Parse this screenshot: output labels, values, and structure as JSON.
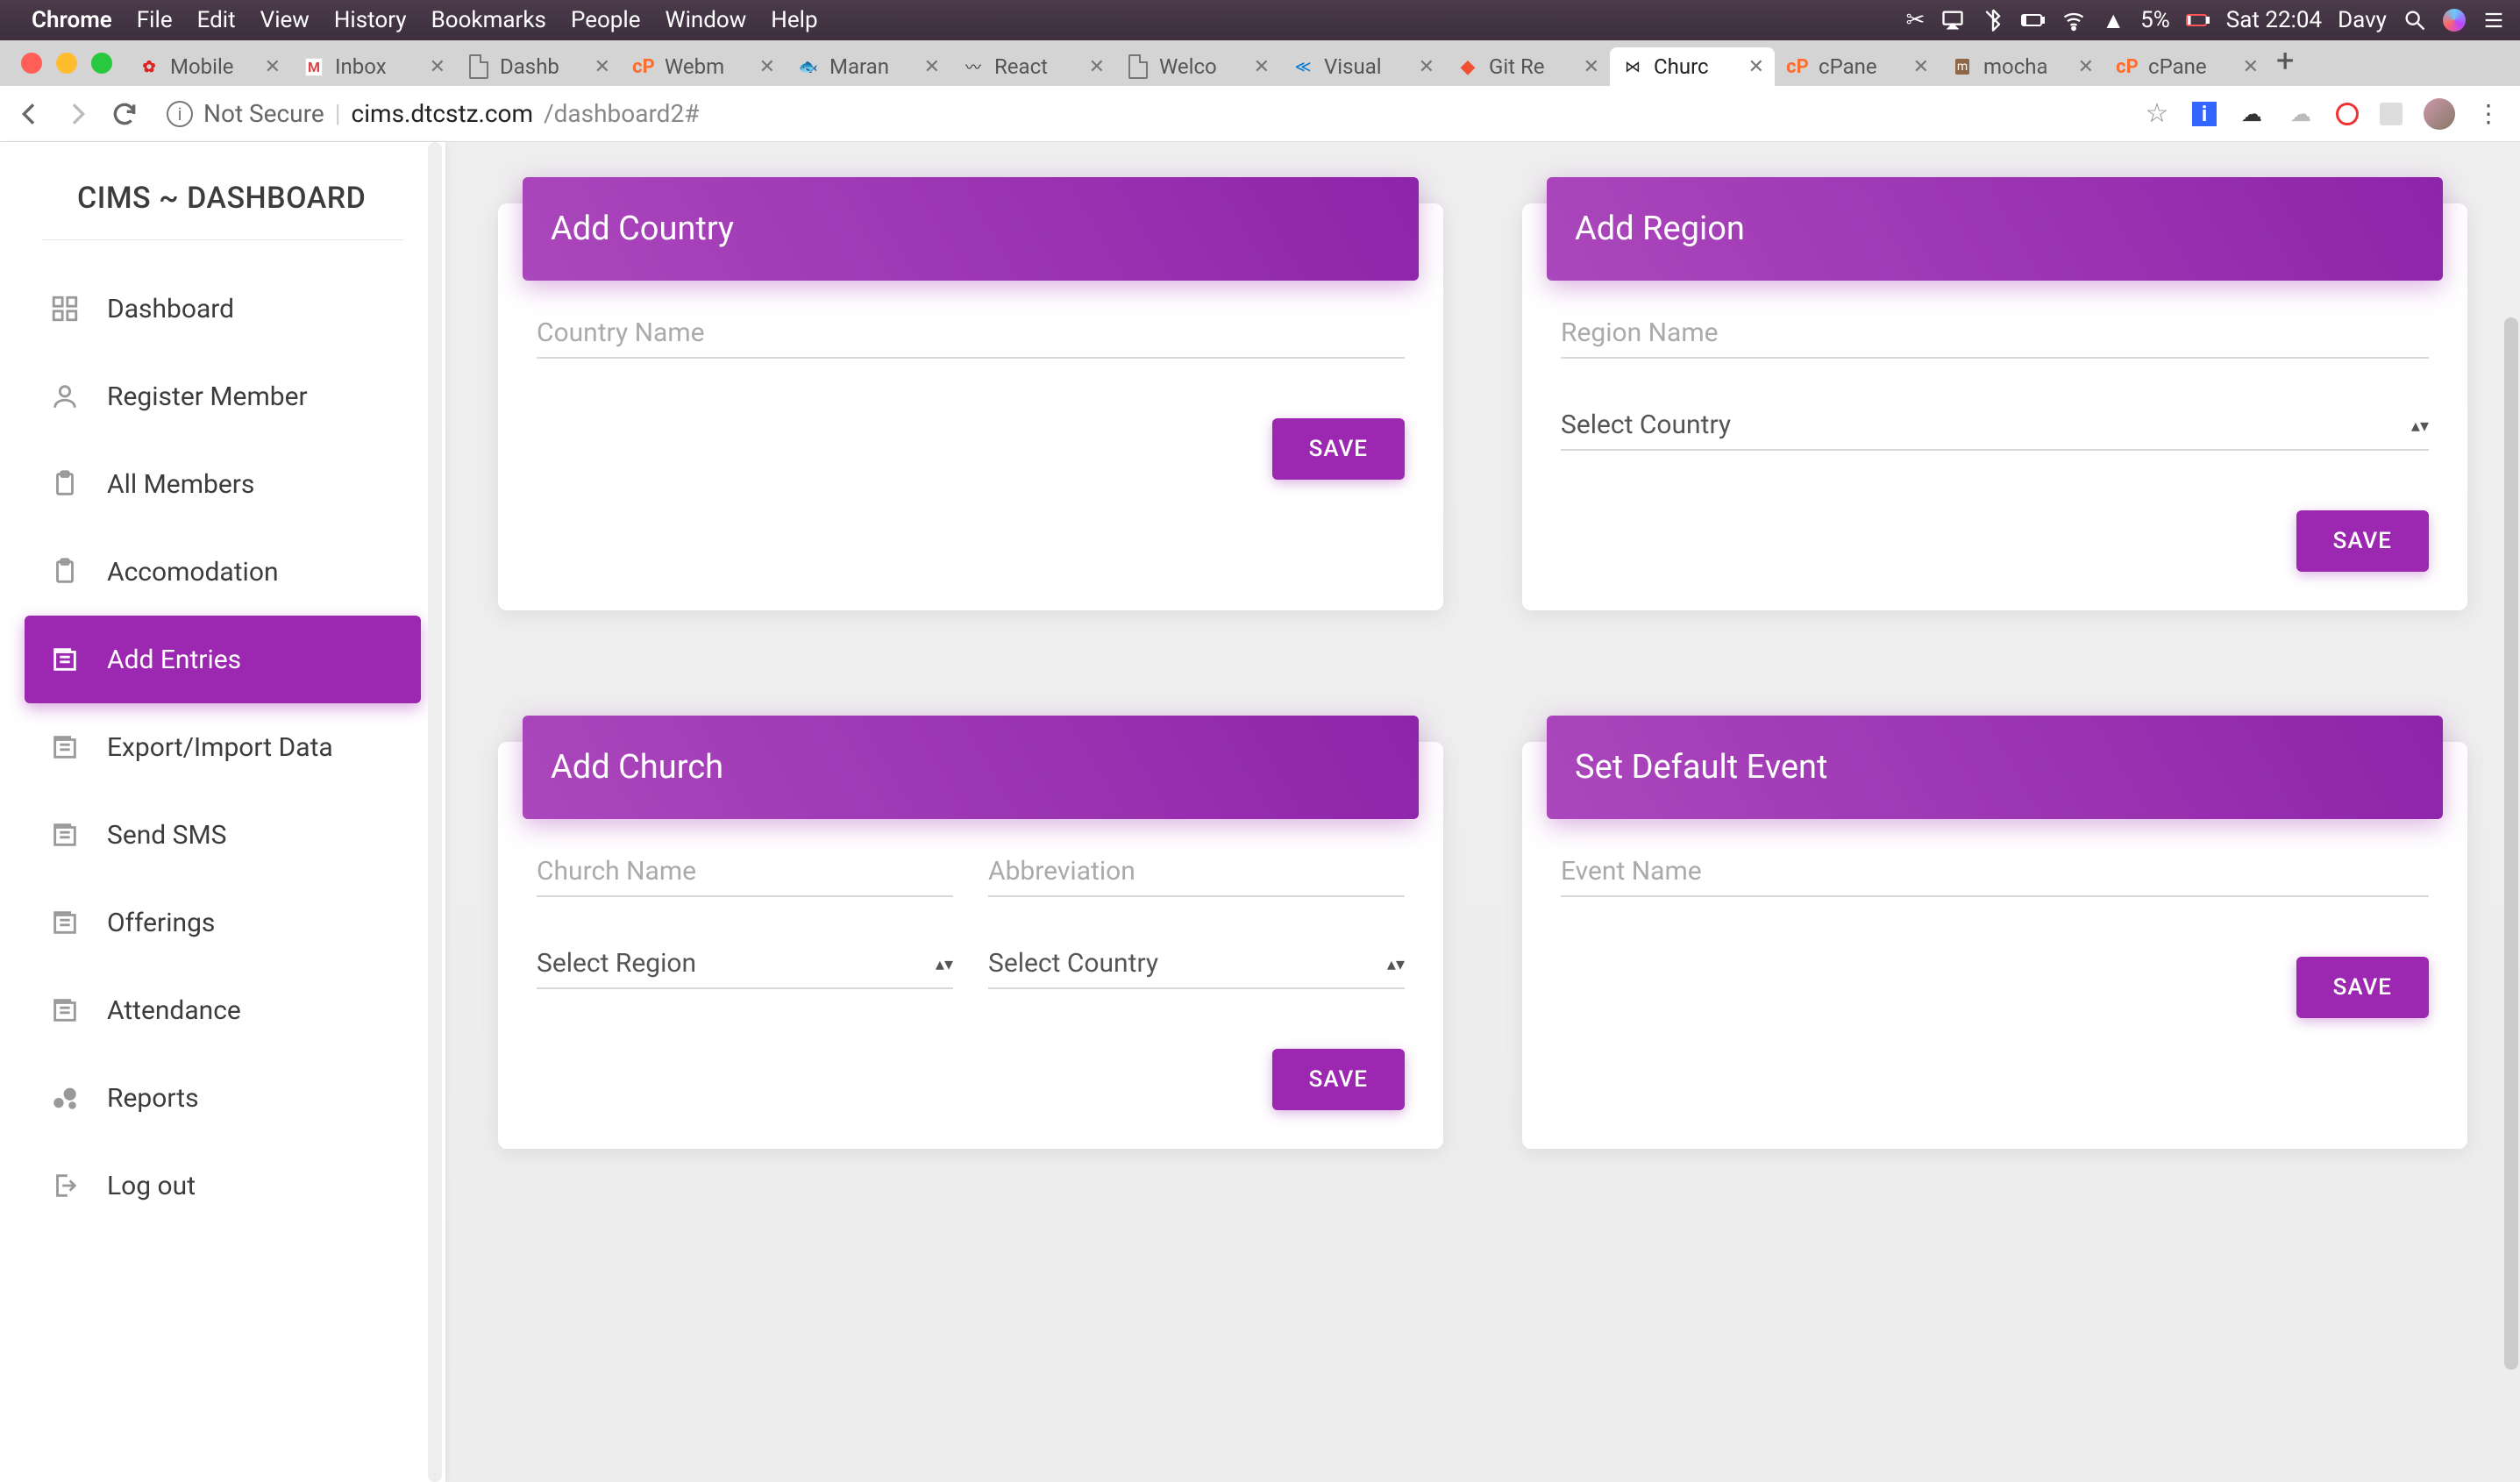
{
  "os": {
    "menus": [
      "File",
      "Edit",
      "View",
      "History",
      "Bookmarks",
      "People",
      "Window",
      "Help"
    ],
    "app_name": "Chrome",
    "battery_pct": "5%",
    "clock": "Sat 22:04",
    "user": "Davy"
  },
  "browser": {
    "tabs": [
      {
        "title": "Mobile",
        "favicon": "huawei"
      },
      {
        "title": "Inbox",
        "favicon": "gmail"
      },
      {
        "title": "Dashb",
        "favicon": "doc"
      },
      {
        "title": "Webm",
        "favicon": "cpanel"
      },
      {
        "title": "Maran",
        "favicon": "maran"
      },
      {
        "title": "React",
        "favicon": "react"
      },
      {
        "title": "Welco",
        "favicon": "doc"
      },
      {
        "title": "Visual",
        "favicon": "vscode"
      },
      {
        "title": "Git Re",
        "favicon": "git"
      },
      {
        "title": "Churc",
        "favicon": "church",
        "active": true
      },
      {
        "title": "cPane",
        "favicon": "cpanel"
      },
      {
        "title": "mocha",
        "favicon": "mocha"
      },
      {
        "title": "cPane",
        "favicon": "cpanel"
      }
    ],
    "not_secure": "Not Secure",
    "url_host": "cims.dtcstz.com",
    "url_path": "/dashboard2#"
  },
  "app": {
    "title": "CIMS ~ DASHBOARD",
    "nav": [
      {
        "label": "Dashboard",
        "icon": "dashboard"
      },
      {
        "label": "Register Member",
        "icon": "person"
      },
      {
        "label": "All Members",
        "icon": "clipboard"
      },
      {
        "label": "Accomodation",
        "icon": "clipboard"
      },
      {
        "label": "Add Entries",
        "icon": "library",
        "active": true
      },
      {
        "label": "Export/Import Data",
        "icon": "library"
      },
      {
        "label": "Send SMS",
        "icon": "library"
      },
      {
        "label": "Offerings",
        "icon": "library"
      },
      {
        "label": "Attendance",
        "icon": "library"
      },
      {
        "label": "Reports",
        "icon": "bubble"
      },
      {
        "label": "Log out",
        "icon": "logout"
      }
    ],
    "cards": {
      "add_country": {
        "title": "Add Country",
        "fields": {
          "country_name_ph": "Country Name"
        },
        "save": "SAVE"
      },
      "add_region": {
        "title": "Add Region",
        "fields": {
          "region_name_ph": "Region Name",
          "select_country": "Select Country"
        },
        "save": "SAVE"
      },
      "add_church": {
        "title": "Add Church",
        "fields": {
          "church_name_ph": "Church Name",
          "abbrev_ph": "Abbreviation",
          "select_region": "Select Region",
          "select_country": "Select Country"
        },
        "save": "SAVE"
      },
      "set_event": {
        "title": "Set Default Event",
        "fields": {
          "event_name_ph": "Event Name"
        },
        "save": "SAVE"
      }
    }
  }
}
